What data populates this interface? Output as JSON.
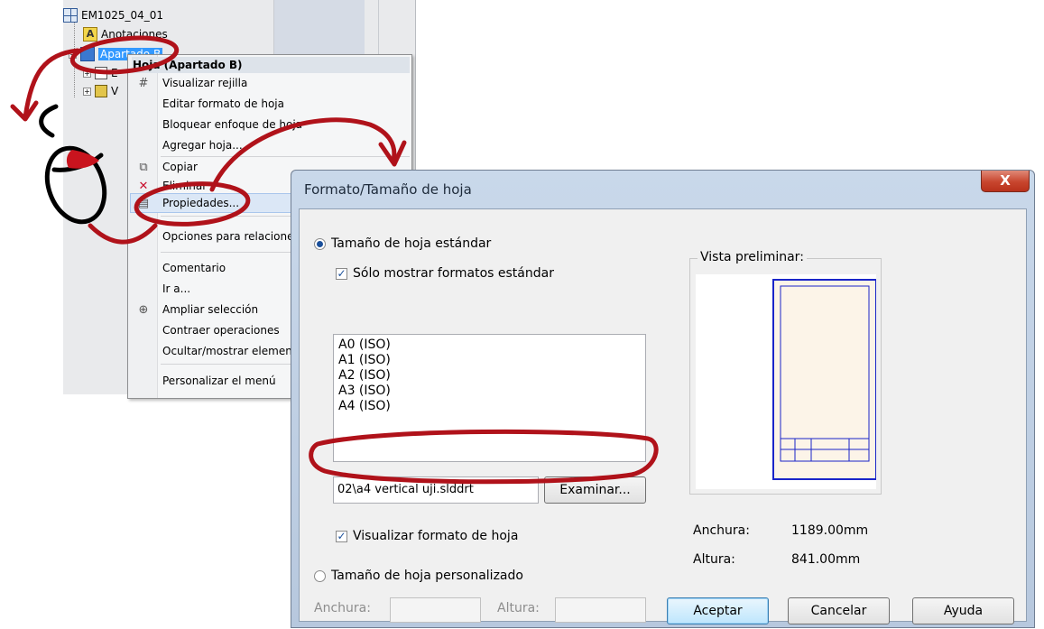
{
  "tree": {
    "root_label": "EM1025_04_01",
    "annotations_label": "Anotaciones",
    "selected_sheet_label": "Apartado B",
    "child_label_1": "E",
    "child_label_2": "V"
  },
  "context_menu": {
    "header": "Hoja (Apartado B)",
    "items": [
      {
        "label": "Visualizar rejilla",
        "icon": "grid-icon"
      },
      {
        "label": "Editar formato de hoja",
        "icon": ""
      },
      {
        "label": "Bloquear enfoque de hoja",
        "icon": ""
      },
      {
        "label": "Agregar hoja...",
        "icon": ""
      },
      {
        "label": "Copiar",
        "icon": "copy-icon"
      },
      {
        "label": "Eliminar",
        "icon": "delete-icon"
      },
      {
        "label": "Propiedades...",
        "icon": "properties-icon"
      },
      {
        "label": "Opciones para relaciones",
        "icon": ""
      },
      {
        "label": "Comentario",
        "icon": ""
      },
      {
        "label": "Ir a...",
        "icon": ""
      },
      {
        "label": "Ampliar selección",
        "icon": "zoom-icon"
      },
      {
        "label": "Contraer operaciones",
        "icon": ""
      },
      {
        "label": "Ocultar/mostrar elementos",
        "icon": ""
      },
      {
        "label": "Personalizar el menú",
        "icon": ""
      }
    ]
  },
  "dialog": {
    "title": "Formato/Tamaño de hoja",
    "close_label": "X",
    "standard_size_label": "Tamaño de hoja estándar",
    "only_standard_label": "Sólo mostrar formatos estándar",
    "formats": [
      "A0 (ISO)",
      "A1 (ISO)",
      "A2 (ISO)",
      "A3 (ISO)",
      "A4 (ISO)"
    ],
    "template_path_value": "02\\a4 vertical uji.slddrt",
    "browse_label": "Examinar...",
    "show_format_label": "Visualizar formato de hoja",
    "custom_size_label": "Tamaño de hoja personalizado",
    "preview_label": "Vista preliminar:",
    "width_label": "Anchura:",
    "width_value": "1189.00mm",
    "height_label": "Altura:",
    "height_value": "841.00mm",
    "custom_width_label": "Anchura:",
    "custom_height_label": "Altura:",
    "ok_label": "Aceptar",
    "cancel_label": "Cancelar",
    "help_label": "Ayuda"
  },
  "colors": {
    "annotation_red": "#b0121a",
    "selection_blue": "#3399ff",
    "preview_border": "#1a25c9"
  }
}
